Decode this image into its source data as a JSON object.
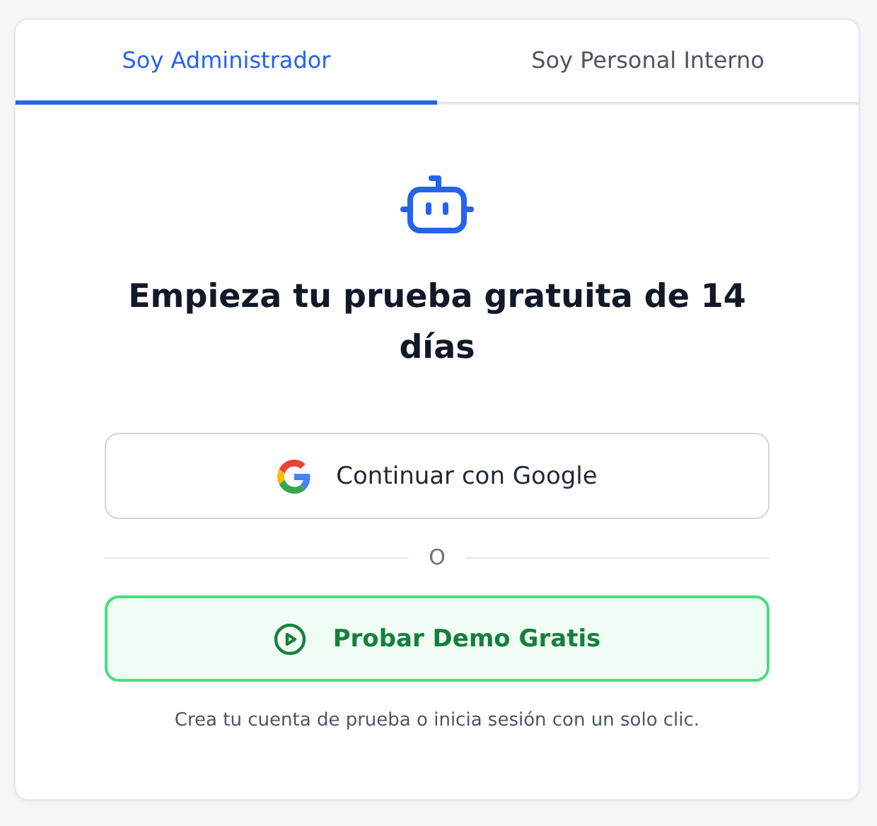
{
  "tabs": [
    {
      "label": "Soy Administrador",
      "selected": true
    },
    {
      "label": "Soy Personal Interno",
      "selected": false
    }
  ],
  "heading": "Empieza tu prueba gratuita de 14 días",
  "google_button": {
    "label": "Continuar con Google"
  },
  "divider": {
    "label": "O"
  },
  "demo_button": {
    "label": "Probar Demo Gratis"
  },
  "footer_note": "Crea tu cuenta de prueba o inicia sesión con un solo clic."
}
